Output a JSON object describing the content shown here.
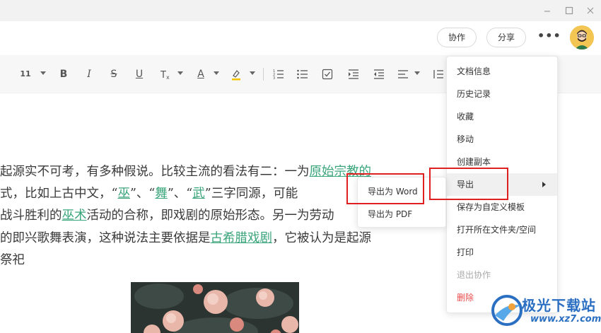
{
  "header": {
    "collab_label": "协作",
    "share_label": "分享",
    "more_label": "•••"
  },
  "toolbar": {
    "font_size": "11",
    "bold": "B",
    "italic": "I",
    "strike": "S",
    "underline": "U",
    "font_color": "A"
  },
  "document": {
    "lines": [
      [
        "起源实不可考，有多种假说。比较主流的看法有二：一为",
        "原始宗教的"
      ],
      [
        "式，比如上古中文，“",
        "巫",
        "”、“",
        "舞",
        "”、“",
        "武",
        "”三字同源，可能"
      ],
      [
        "战斗胜利的",
        "巫术",
        "活动的合称，即戏剧的原始形态。另一为劳动"
      ],
      [
        "的即兴歌舞表演，这种说法主要依据是",
        "古希腊戏剧",
        "，它被认为是起源"
      ],
      [
        "祭祀"
      ]
    ]
  },
  "menu": {
    "items": [
      {
        "label": "文档信息"
      },
      {
        "label": "历史记录"
      },
      {
        "label": "收藏"
      },
      {
        "label": "移动"
      },
      {
        "label": "创建副本"
      },
      {
        "label": "导出"
      },
      {
        "label": "保存为自定义模板"
      },
      {
        "label": "打开所在文件夹/空间"
      },
      {
        "label": "打印"
      },
      {
        "label": "退出协作"
      },
      {
        "label": "删除"
      }
    ]
  },
  "submenu": {
    "items": [
      {
        "label": "导出为 Word"
      },
      {
        "label": "导出为 PDF"
      }
    ]
  },
  "watermark": {
    "brand": "极光下载站",
    "url": "www.xz7.com"
  },
  "colors": {
    "link": "#3aa57a",
    "highlight": "#e02020",
    "danger": "#e84a4a",
    "watermark": "#2b6fc2"
  }
}
